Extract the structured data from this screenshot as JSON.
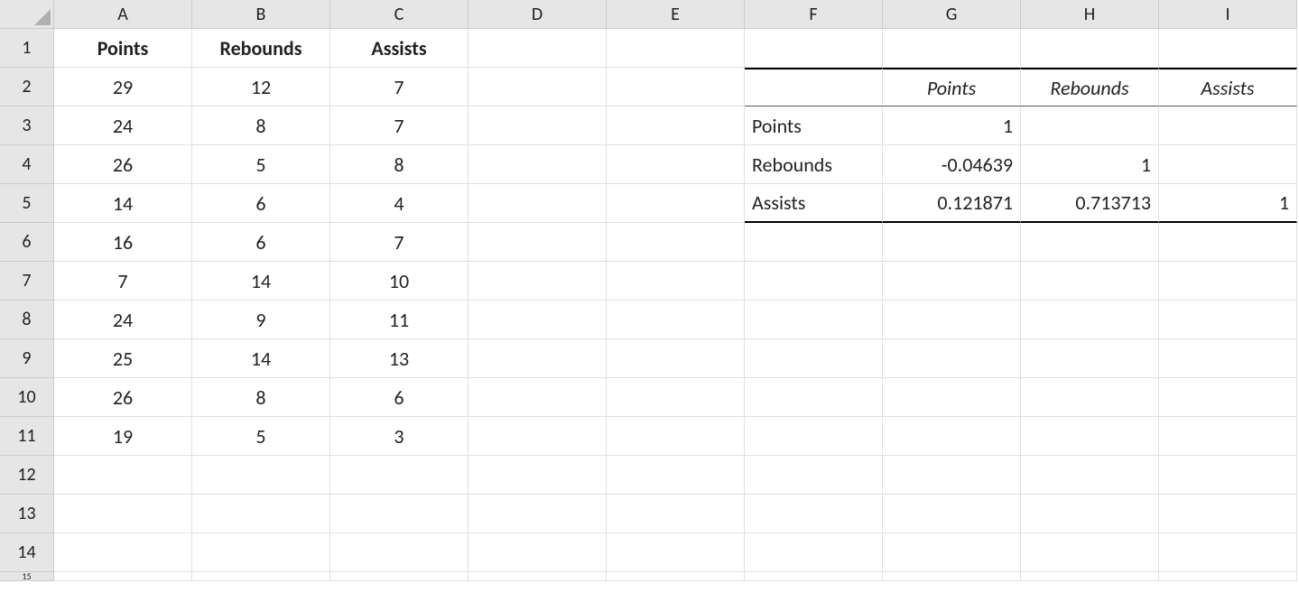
{
  "columns": [
    "A",
    "B",
    "C",
    "D",
    "E",
    "F",
    "G",
    "H",
    "I"
  ],
  "rows": [
    "1",
    "2",
    "3",
    "4",
    "5",
    "6",
    "7",
    "8",
    "9",
    "10",
    "11",
    "12",
    "13",
    "14",
    "15"
  ],
  "data_table": {
    "headers": {
      "A": "Points",
      "B": "Rebounds",
      "C": "Assists"
    },
    "rows": [
      {
        "A": "29",
        "B": "12",
        "C": "7"
      },
      {
        "A": "24",
        "B": "8",
        "C": "7"
      },
      {
        "A": "26",
        "B": "5",
        "C": "8"
      },
      {
        "A": "14",
        "B": "6",
        "C": "4"
      },
      {
        "A": "16",
        "B": "6",
        "C": "7"
      },
      {
        "A": "7",
        "B": "14",
        "C": "10"
      },
      {
        "A": "24",
        "B": "9",
        "C": "11"
      },
      {
        "A": "25",
        "B": "14",
        "C": "13"
      },
      {
        "A": "26",
        "B": "8",
        "C": "6"
      },
      {
        "A": "19",
        "B": "5",
        "C": "3"
      }
    ]
  },
  "corr_matrix": {
    "col_headers": {
      "G": "Points",
      "H": "Rebounds",
      "I": "Assists"
    },
    "row_labels": {
      "r3": "Points",
      "r4": "Rebounds",
      "r5": "Assists"
    },
    "values": {
      "r3": {
        "G": "1",
        "H": "",
        "I": ""
      },
      "r4": {
        "G": "-0.04639",
        "H": "1",
        "I": ""
      },
      "r5": {
        "G": "0.121871",
        "H": "0.713713",
        "I": "1"
      }
    }
  }
}
